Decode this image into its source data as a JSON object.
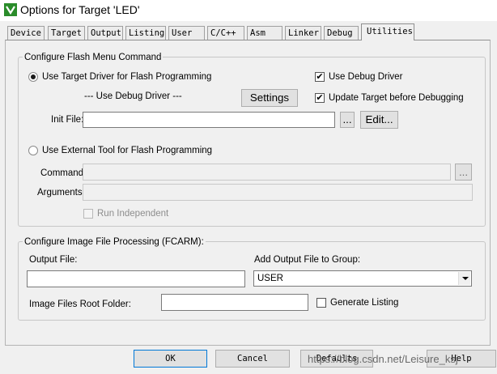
{
  "window": {
    "title": "Options for Target 'LED'",
    "icon": "keil-uvision-icon"
  },
  "tabs": [
    {
      "label": "Device",
      "active": false
    },
    {
      "label": "Target",
      "active": false
    },
    {
      "label": "Output",
      "active": false
    },
    {
      "label": "Listing",
      "active": false
    },
    {
      "label": "User",
      "active": false
    },
    {
      "label": "C/C++",
      "active": false
    },
    {
      "label": "Asm",
      "active": false
    },
    {
      "label": "Linker",
      "active": false
    },
    {
      "label": "Debug",
      "active": false
    },
    {
      "label": "Utilities",
      "active": true
    }
  ],
  "flash": {
    "group_label": "Configure Flash Menu Command",
    "use_target_driver_label": "Use Target Driver for Flash Programming",
    "use_target_driver_selected": true,
    "driver_text": "--- Use Debug Driver ---",
    "settings_button": "Settings",
    "use_debug_driver_label": "Use Debug Driver",
    "use_debug_driver_checked": true,
    "update_target_label": "Update Target before Debugging",
    "update_target_checked": true,
    "init_file_label": "Init File:",
    "init_file_value": "",
    "browse_button": "...",
    "edit_button": "Edit...",
    "use_external_label": "Use External Tool for Flash Programming",
    "use_external_selected": false,
    "command_label": "Command:",
    "command_value": "",
    "command_browse_button": "...",
    "arguments_label": "Arguments:",
    "arguments_value": "",
    "run_independent_label": "Run Independent",
    "run_independent_checked": false
  },
  "image": {
    "group_label": "Configure Image File Processing (FCARM):",
    "output_file_label": "Output File:",
    "output_file_value": "",
    "add_output_label": "Add Output File  to Group:",
    "group_selected": "USER",
    "root_folder_label": "Image Files Root Folder:",
    "root_folder_value": "",
    "generate_listing_label": "Generate Listing",
    "generate_listing_checked": false
  },
  "buttons": {
    "ok": "OK",
    "cancel": "Cancel",
    "defaults": "Defaults",
    "help": "Help"
  },
  "watermark": "https://blog.csdn.net/Leisure_ksj",
  "check_mark": "✔"
}
